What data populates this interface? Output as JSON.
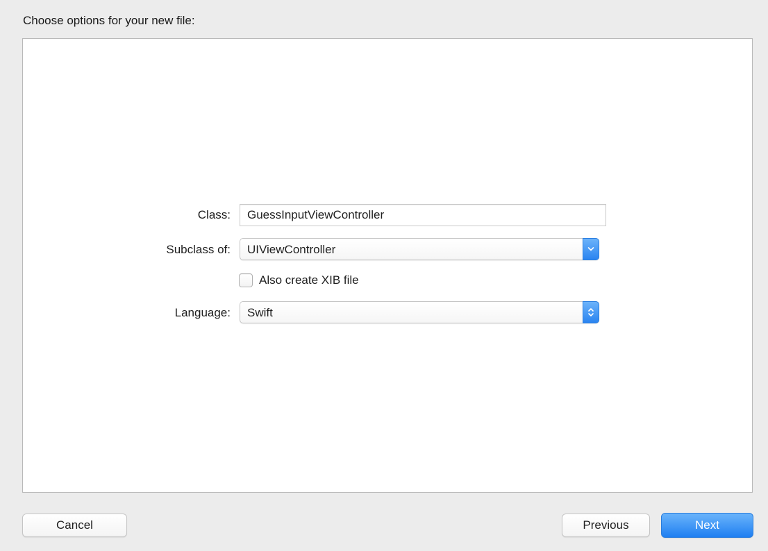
{
  "dialog": {
    "heading": "Choose options for your new file:"
  },
  "form": {
    "class_label": "Class:",
    "class_value": "GuessInputViewController",
    "subclass_label": "Subclass of:",
    "subclass_value": "UIViewController",
    "xib_checkbox_label": "Also create XIB file",
    "xib_checked": false,
    "language_label": "Language:",
    "language_value": "Swift"
  },
  "buttons": {
    "cancel": "Cancel",
    "previous": "Previous",
    "next": "Next"
  },
  "colors": {
    "accent": "#2a84f0",
    "background": "#ececec",
    "panel": "#ffffff"
  },
  "icons": {
    "subclass_popup": "chevron-down-icon",
    "language_popup": "up-down-chevron-icon"
  }
}
